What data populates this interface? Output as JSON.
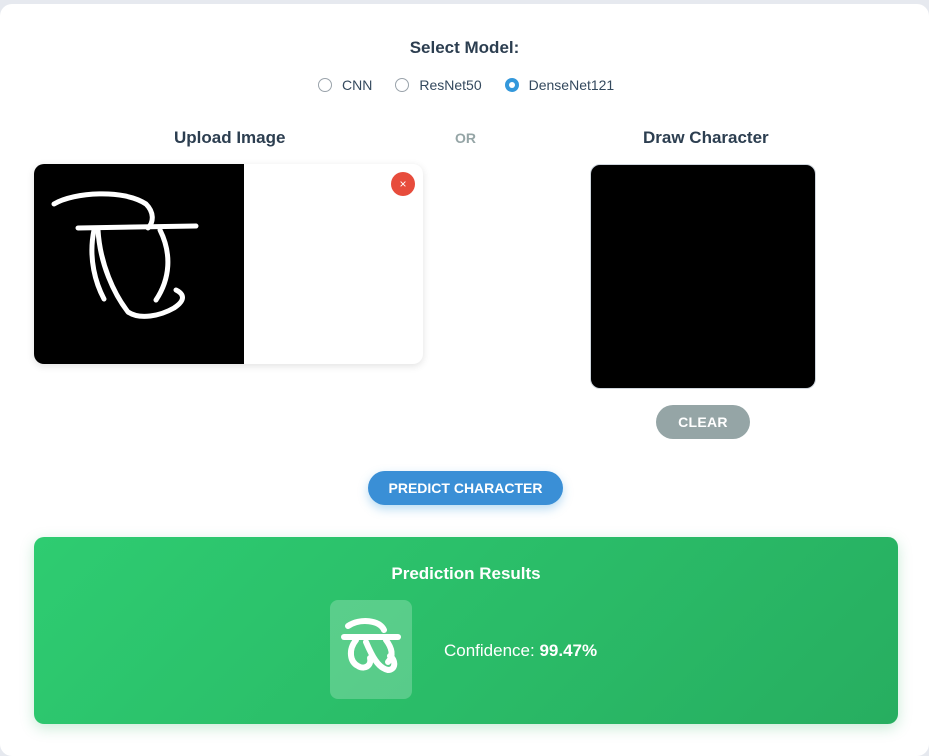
{
  "model_select": {
    "title": "Select Model:",
    "options": [
      {
        "label": "CNN",
        "checked": false
      },
      {
        "label": "ResNet50",
        "checked": false
      },
      {
        "label": "DenseNet121",
        "checked": true
      }
    ]
  },
  "upload": {
    "heading": "Upload Image",
    "remove_label": "×"
  },
  "separator": "OR",
  "draw": {
    "heading": "Draw Character",
    "clear_label": "CLEAR"
  },
  "predict_label": "PREDICT CHARACTER",
  "results": {
    "title": "Prediction Results",
    "predicted_char_icon": "bengali-character-glyph",
    "confidence_label": "Confidence:",
    "confidence_value": "99.47%"
  },
  "colors": {
    "accent": "#3498db",
    "success": "#2ecc71",
    "danger": "#e74c3c",
    "muted": "#95a5a6"
  }
}
